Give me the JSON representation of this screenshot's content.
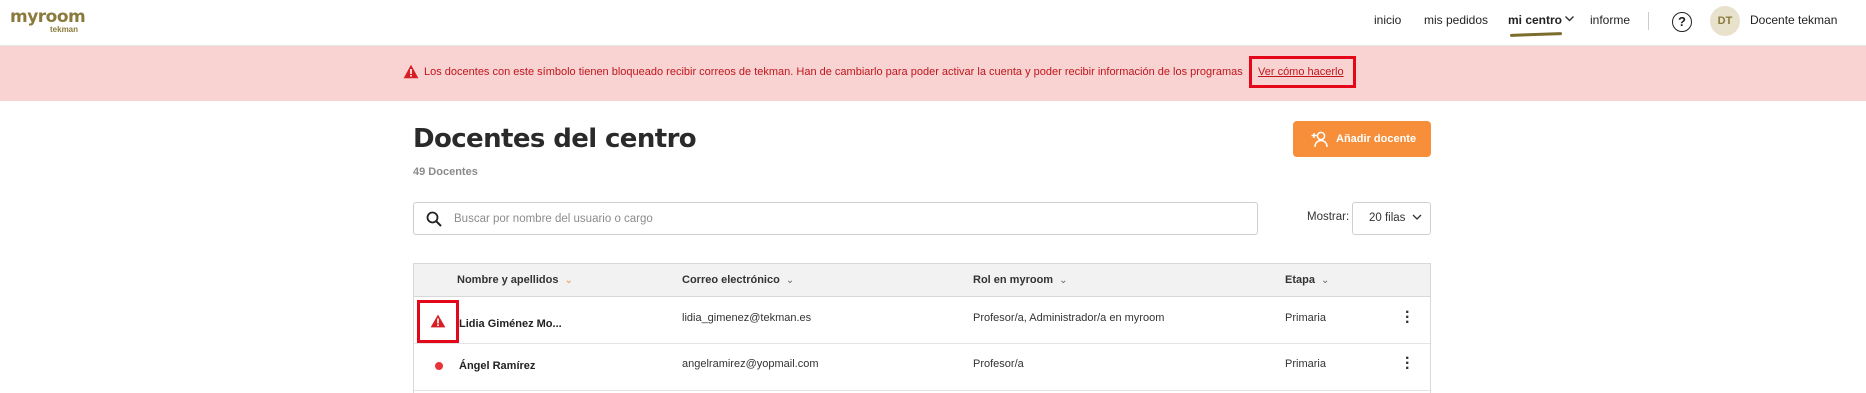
{
  "nav": {
    "logo_brand": "myroom",
    "logo_sub": "tekman",
    "links": [
      "inicio",
      "mis pedidos",
      "mi centro",
      "informe"
    ],
    "help": "?",
    "avatar_initials": "DT",
    "user_name": "Docente tekman"
  },
  "alert": {
    "message": "Los docentes con este símbolo tienen bloqueado recibir correos de tekman. Han de cambiarlo para poder activar la cuenta y poder recibir información de los programas",
    "link": "Ver cómo hacerlo"
  },
  "page": {
    "title": "Docentes del centro",
    "count": "49 Docentes",
    "add_button": "Añadir docente"
  },
  "search": {
    "placeholder": "Buscar por nombre del usuario o cargo"
  },
  "rows_select": {
    "label": "Mostrar:",
    "value": "20 filas"
  },
  "table": {
    "headers": [
      "Nombre y apellidos",
      "Correo electrónico",
      "Rol en myroom",
      "Etapa"
    ],
    "rows": [
      {
        "name": "Lidia Giménez Mo...",
        "email": "lidia_gimenez@tekman.es",
        "role": "Profesor/a, Administrador/a en myroom",
        "stage": "Primaria",
        "status": "warning"
      },
      {
        "name": "Ángel Ramírez",
        "email": "angelramirez@yopmail.com",
        "role": "Profesor/a",
        "stage": "Primaria",
        "status": "dot"
      }
    ]
  },
  "colors": {
    "brand": "#8a7a3c",
    "accent": "#f78f3a",
    "alert_bg": "#f8d3d2",
    "alert_text": "#c0151c",
    "highlight": "#e4071a"
  }
}
